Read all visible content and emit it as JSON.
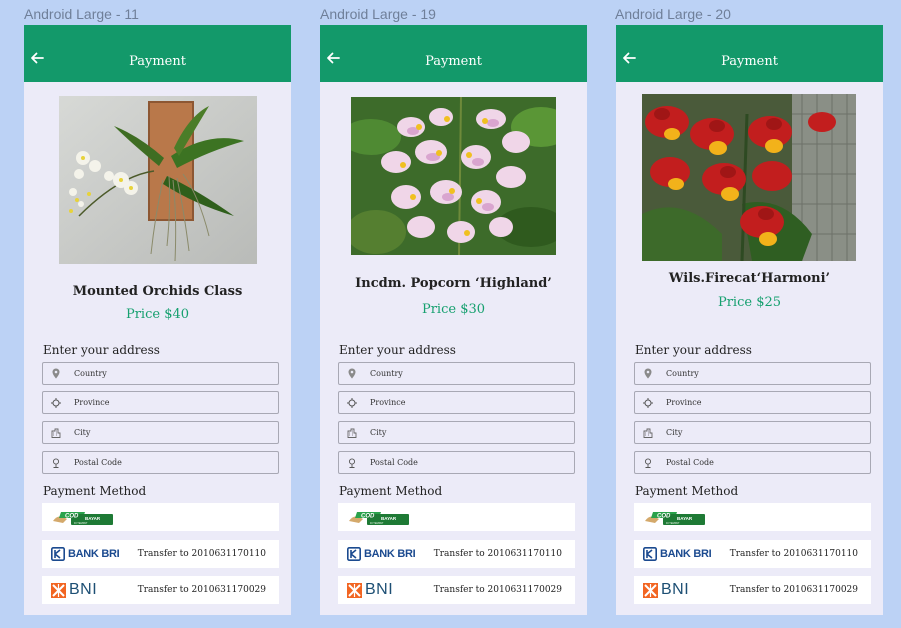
{
  "frames": [
    {
      "label": "Android Large - 11",
      "title": "Payment",
      "product_name": "Mounted Orchids Class",
      "price": "Price $40",
      "address_label": "Enter your address",
      "fields": [
        "Country",
        "Province",
        "City",
        "Postal Code"
      ],
      "payment_label": "Payment Method",
      "cod": {
        "main": "COD",
        "badge": "BAYAR",
        "sub": "DI TEMPAT"
      },
      "bri": {
        "name": "BANK BRI",
        "note": "Transfer to 2010631170110"
      },
      "bni": {
        "name": "BNI",
        "note": "Transfer to 2010631170029"
      }
    },
    {
      "label": "Android Large - 19",
      "title": "Payment",
      "product_name": "Incdm. Popcorn ‘Highland’",
      "price": "Price $30",
      "address_label": "Enter your address",
      "fields": [
        "Country",
        "Province",
        "City",
        "Postal Code"
      ],
      "payment_label": "Payment Method",
      "cod": {
        "main": "COD",
        "badge": "BAYAR",
        "sub": "DI TEMPAT"
      },
      "bri": {
        "name": "BANK BRI",
        "note": "Transfer to 2010631170110"
      },
      "bni": {
        "name": "BNI",
        "note": "Transfer to 2010631170029"
      }
    },
    {
      "label": "Android Large - 20",
      "title": "Payment",
      "product_name": "Wils.Firecat‘Harmoni’",
      "price": "Price $25",
      "address_label": "Enter your address",
      "fields": [
        "Country",
        "Province",
        "City",
        "Postal Code"
      ],
      "payment_label": "Payment Method",
      "cod": {
        "main": "COD",
        "badge": "BAYAR",
        "sub": "DI TEMPAT"
      },
      "bri": {
        "name": "BANK BRI",
        "note": "Transfer to 2010631170110"
      },
      "bni": {
        "name": "BNI",
        "note": "Transfer to 2010631170029"
      }
    }
  ],
  "icons": {
    "back": "arrow-left-icon",
    "fields": [
      "location-pin-icon",
      "crosshair-icon",
      "building-icon",
      "pin-outline-icon"
    ]
  },
  "colors": {
    "background": "#bcd2f5",
    "appbar": "#13996a",
    "price": "#16a06f",
    "screen": "#ecebf8"
  }
}
